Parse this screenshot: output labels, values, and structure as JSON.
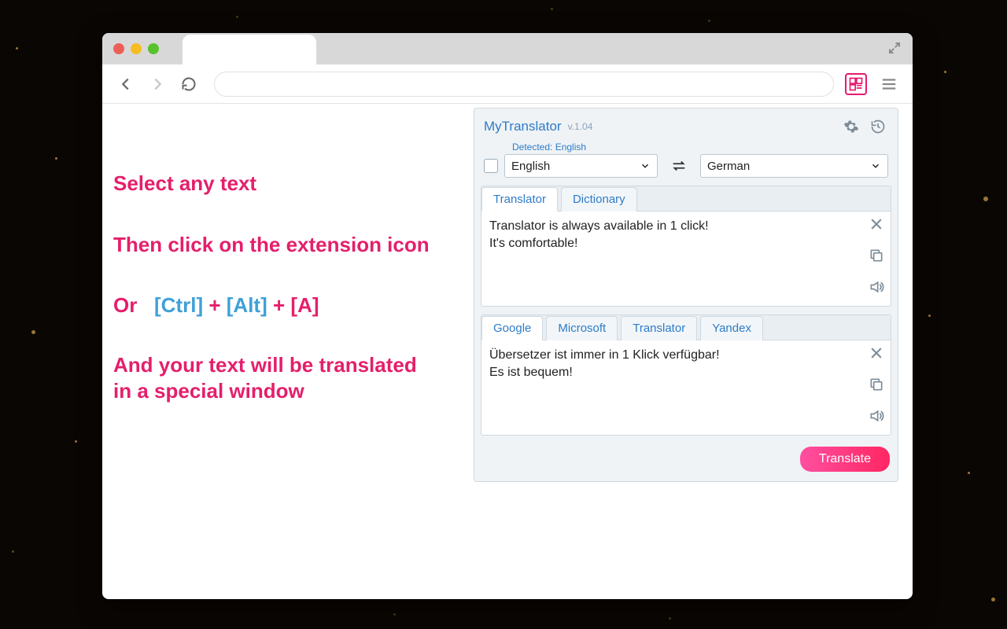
{
  "marketing": {
    "line1": "Select any text",
    "line2": "Then click on the extension icon",
    "or": "Or",
    "keys": {
      "ctrl": "[Ctrl]",
      "plus": "+",
      "alt": "[Alt]",
      "a": "[A]"
    },
    "line4a": "And your text will be translated",
    "line4b": "in a special window"
  },
  "popup": {
    "title": "MyTranslator",
    "version": "v.1.04",
    "detected": "Detected: English",
    "source_lang": "English",
    "target_lang": "German",
    "input_tabs": {
      "translator": "Translator",
      "dictionary": "Dictionary"
    },
    "input_text": "Translator is always available in 1 click!\nIt's comfortable!",
    "output_tabs": {
      "google": "Google",
      "microsoft": "Microsoft",
      "translator": "Translator",
      "yandex": "Yandex"
    },
    "output_text": "Übersetzer ist immer in 1 Klick verfügbar!\nEs ist bequem!",
    "translate_button": "Translate"
  }
}
